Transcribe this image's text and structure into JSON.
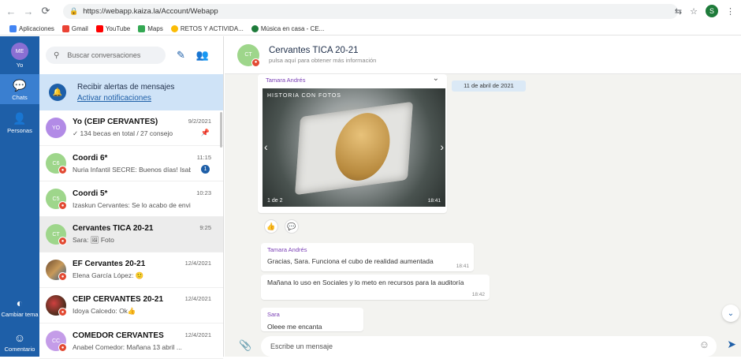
{
  "browser": {
    "url": "https://webapp.kaiza.la/Account/Webapp",
    "profile_initial": "S",
    "bookmarks": [
      "Aplicaciones",
      "Gmail",
      "YouTube",
      "Maps",
      "RETOS Y ACTIVIDA...",
      "Música en casa - CE..."
    ]
  },
  "rail": {
    "me_initials": "ME",
    "me_label": "Yo",
    "chats_label": "Chats",
    "people_label": "Personas",
    "theme_label": "Cambiar tema",
    "comment_label": "Comentario"
  },
  "sidebar": {
    "search_placeholder": "Buscar conversaciones",
    "alert_title": "Recibir alertas de mensajes",
    "alert_link": "Activar notificaciones",
    "chats": [
      {
        "initials": "YO",
        "name": "Yo (CEIP CERVANTES)",
        "preview": "✓ 134 becas en total / 27 consejo",
        "time": "9/2/2021",
        "pinned": "📌"
      },
      {
        "initials": "C6",
        "name": "Coordi 6*",
        "preview": "Nuria Infantil SECRE: Buenos días! Isab...",
        "time": "11:15",
        "unread": "1"
      },
      {
        "initials": "C5",
        "name": "Coordi 5*",
        "preview": "Izaskun Cervantes: Se lo acabo de envi...",
        "time": "10:23"
      },
      {
        "initials": "CT",
        "name": "Cervantes TICA 20-21",
        "preview": "Sara: 🖼 Foto",
        "time": "9:25"
      },
      {
        "initials": "",
        "name": "EF Cervantes 20-21",
        "preview": "Elena García López: 🙂",
        "time": "12/4/2021"
      },
      {
        "initials": "",
        "name": "CEIP CERVANTES 20-21",
        "preview": "Idoya Calcedo: Ok👍",
        "time": "12/4/2021"
      },
      {
        "initials": "CC",
        "name": "COMEDOR CERVANTES",
        "preview": "Anabel Comedor: Mañana 13 abril ...",
        "time": "12/4/2021"
      }
    ]
  },
  "conversation": {
    "initials": "CT",
    "title": "Cervantes TICA 20-21",
    "subtitle": "pulsa aquí para obtener más información",
    "date_pill": "11 de abril de 2021",
    "photo_sender": "Tamara Andrés",
    "photo_label": "HISTORIA CON FOTOS",
    "photo_count": "1 de 2",
    "photo_time": "18:41",
    "msg1_sender": "Tamara Andrés",
    "msg1_text": "Gracias, Sara. Funciona el cubo de realidad aumentada",
    "msg1_time": "18:41",
    "msg2_text": "Mañana lo uso en Sociales y lo meto en recursos para la auditoría",
    "msg2_time": "18:42",
    "msg3_sender": "Sara",
    "msg3_text": "Oleee me encanta",
    "composer_placeholder": "Escribe un mensaje"
  }
}
